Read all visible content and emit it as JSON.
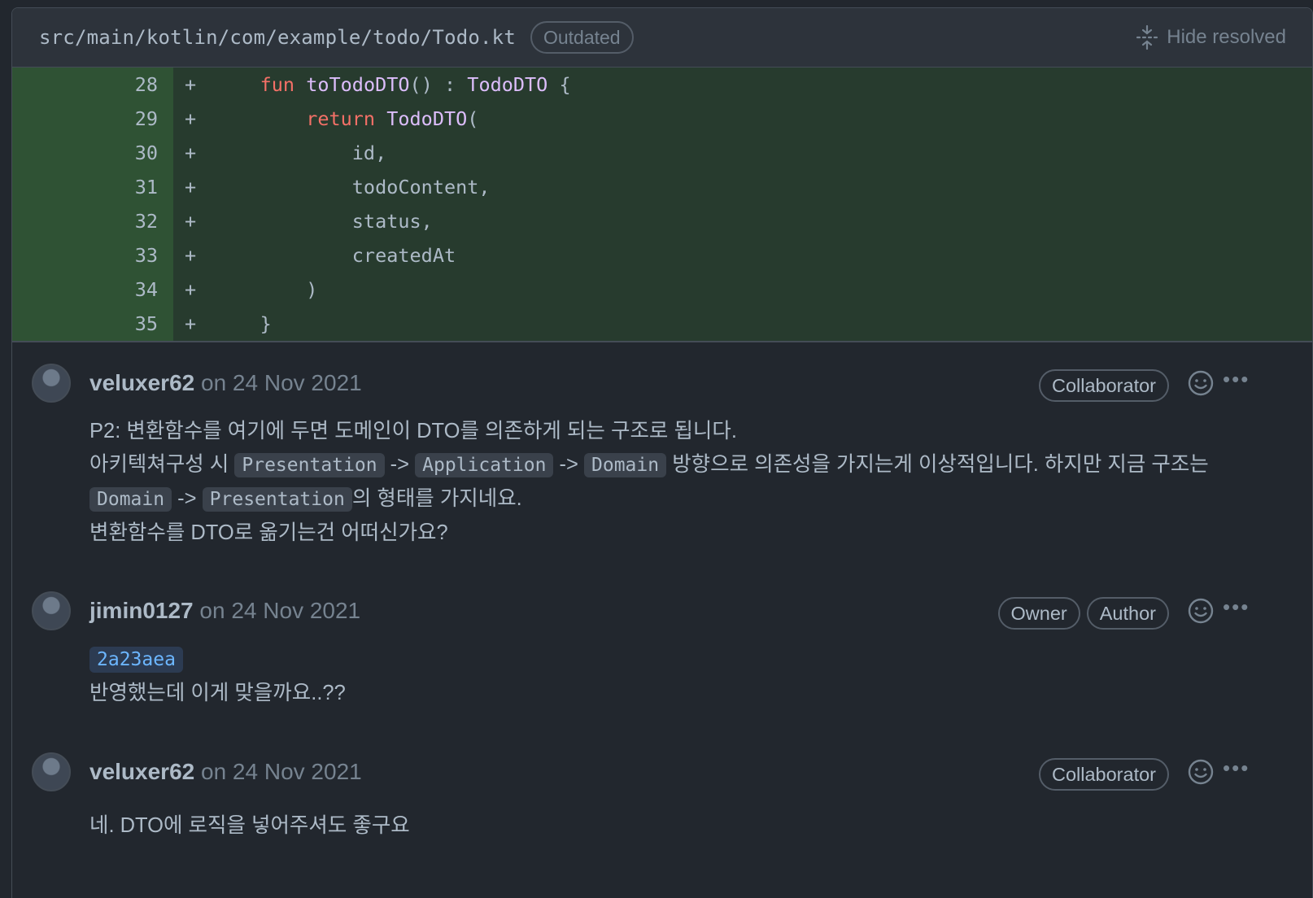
{
  "file": {
    "path": "src/main/kotlin/com/example/todo/Todo.kt",
    "status_label": "Outdated",
    "hide_resolved_label": "Hide resolved"
  },
  "diff": {
    "rows": [
      {
        "line": "28",
        "sign": "+"
      },
      {
        "line": "29",
        "sign": "+"
      },
      {
        "line": "30",
        "sign": "+"
      },
      {
        "line": "31",
        "sign": "+"
      },
      {
        "line": "32",
        "sign": "+"
      },
      {
        "line": "33",
        "sign": "+"
      },
      {
        "line": "34",
        "sign": "+"
      },
      {
        "line": "35",
        "sign": "+"
      }
    ],
    "code": {
      "l28_kw": "fun",
      "l28_fn": "toTodoDTO",
      "l28_mid": "() : ",
      "l28_type": "TodoDTO",
      "l28_end": " {",
      "l29_kw": "return",
      "l29_fn": "TodoDTO",
      "l29_end": "(",
      "l30": "id,",
      "l31": "todoContent,",
      "l32": "status,",
      "l33": "createdAt",
      "l34": ")",
      "l35": "}"
    }
  },
  "comments": [
    {
      "author": "veluxer62",
      "date": "on 24 Nov 2021",
      "badges": [
        "Collaborator"
      ],
      "line1": "P2: 변환함수를 여기에 두면 도메인이 DTO를 의존하게 되는 구조로 됩니다.",
      "line2_a": "아키텍쳐구성 시 ",
      "code_presentation": "Presentation",
      "arrow": " -> ",
      "code_application": "Application",
      "code_domain": "Domain",
      "line2_b": " 방향으로 의존성을 가지는게 이상적입니다. 하지만 지금 구조는",
      "line3_b": "의 형태를 가지네요.",
      "line4": "변환함수를 DTO로 옮기는건 어떠신가요?"
    },
    {
      "author": "jimin0127",
      "date": "on 24 Nov 2021",
      "badges": [
        "Owner",
        "Author"
      ],
      "commit": "2a23aea",
      "line1": "반영했는데 이게 맞을까요..??"
    },
    {
      "author": "veluxer62",
      "date": "on 24 Nov 2021",
      "badges": [
        "Collaborator"
      ],
      "line1": "네. DTO에 로직을 넣어주셔도 좋구요"
    }
  ],
  "icons": {
    "hide_resolved": "unfold-icon",
    "reaction": "smiley-icon",
    "more": "kebab-horizontal-icon"
  },
  "more_glyph": "•••",
  "colors": {
    "background": "#22272e",
    "added_line": "#273b2e",
    "keyword": "#f47067",
    "function": "#dcbdfb",
    "link": "#6cb6ff"
  }
}
